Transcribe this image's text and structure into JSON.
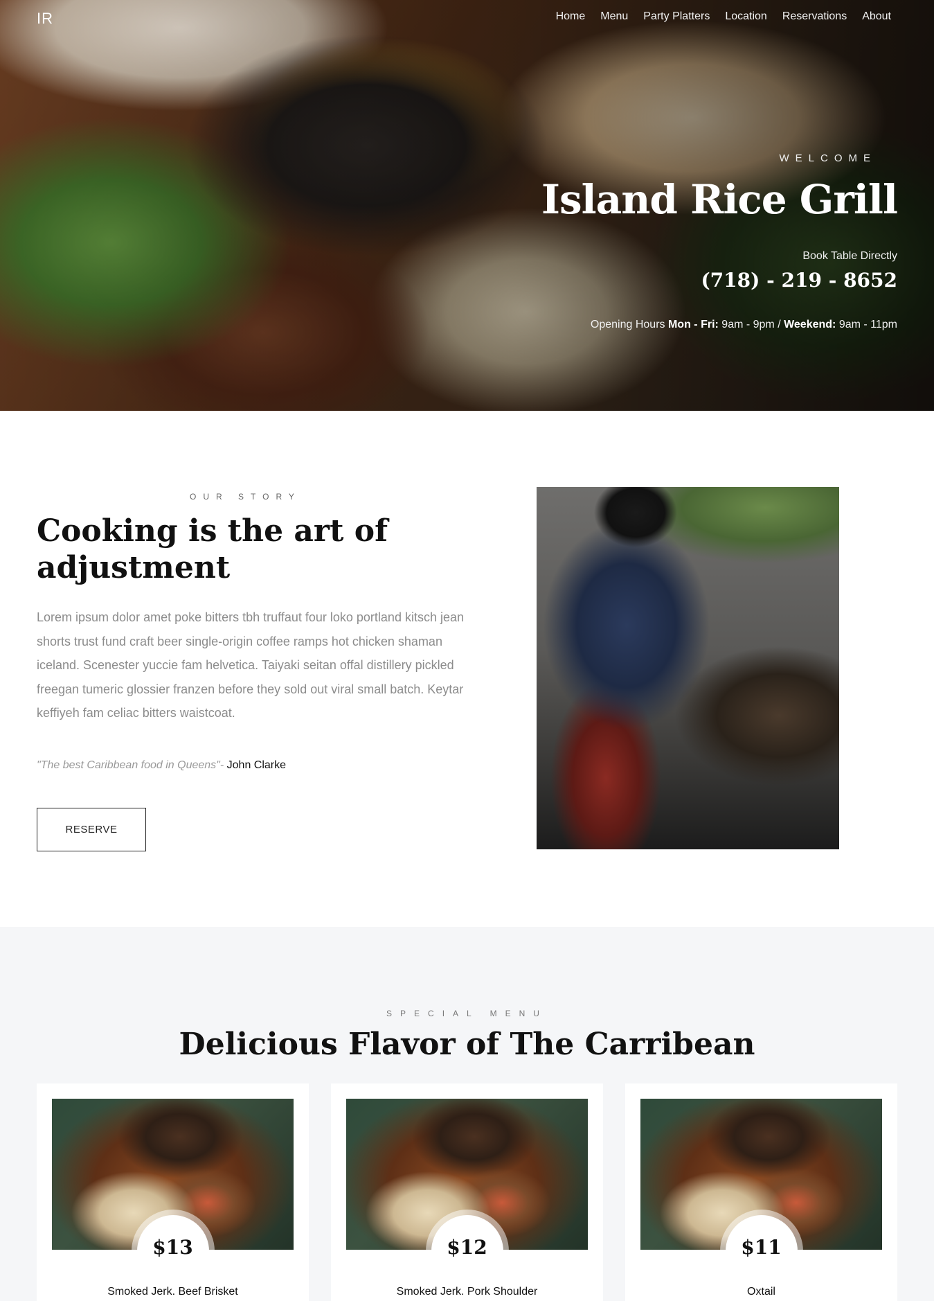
{
  "header": {
    "logo": "IR",
    "nav": [
      "Home",
      "Menu",
      "Party Platters",
      "Location",
      "Reservations",
      "About"
    ]
  },
  "hero": {
    "welcome": "WELCOME",
    "title": "Island Rice Grill",
    "book_label": "Book Table Directly",
    "phone": "(718) - 219 - 8652",
    "hours_prefix": "Opening Hours ",
    "weekday_label": "Mon - Fri:",
    "weekday_hours": " 9am - 9pm / ",
    "weekend_label": "Weekend:",
    "weekend_hours": " 9am - 11pm"
  },
  "story": {
    "eyebrow": "OUR STORY",
    "title": "Cooking is the art of adjustment",
    "body": "Lorem ipsum dolor amet poke bitters tbh truffaut four loko portland kitsch jean shorts trust fund craft beer single-origin coffee ramps hot chicken shaman iceland. Scenester yuccie fam helvetica. Taiyaki seitan offal distillery pickled freegan tumeric glossier franzen before they sold out viral small batch. Keytar keffiyeh fam celiac bitters waistcoat.",
    "quote": "\"The best Caribbean food in Queens\"",
    "quote_sep": "- ",
    "quote_author": "John Clarke",
    "reserve_label": "RESERVE"
  },
  "menu": {
    "eyebrow": "SPECIAL MENU",
    "title": "Delicious Flavor of The Carribean",
    "items": [
      {
        "price": "$13",
        "name": "Smoked Jerk. Beef Brisket"
      },
      {
        "price": "$12",
        "name": "Smoked Jerk. Pork Shoulder"
      },
      {
        "price": "$11",
        "name": "Oxtail"
      }
    ]
  }
}
